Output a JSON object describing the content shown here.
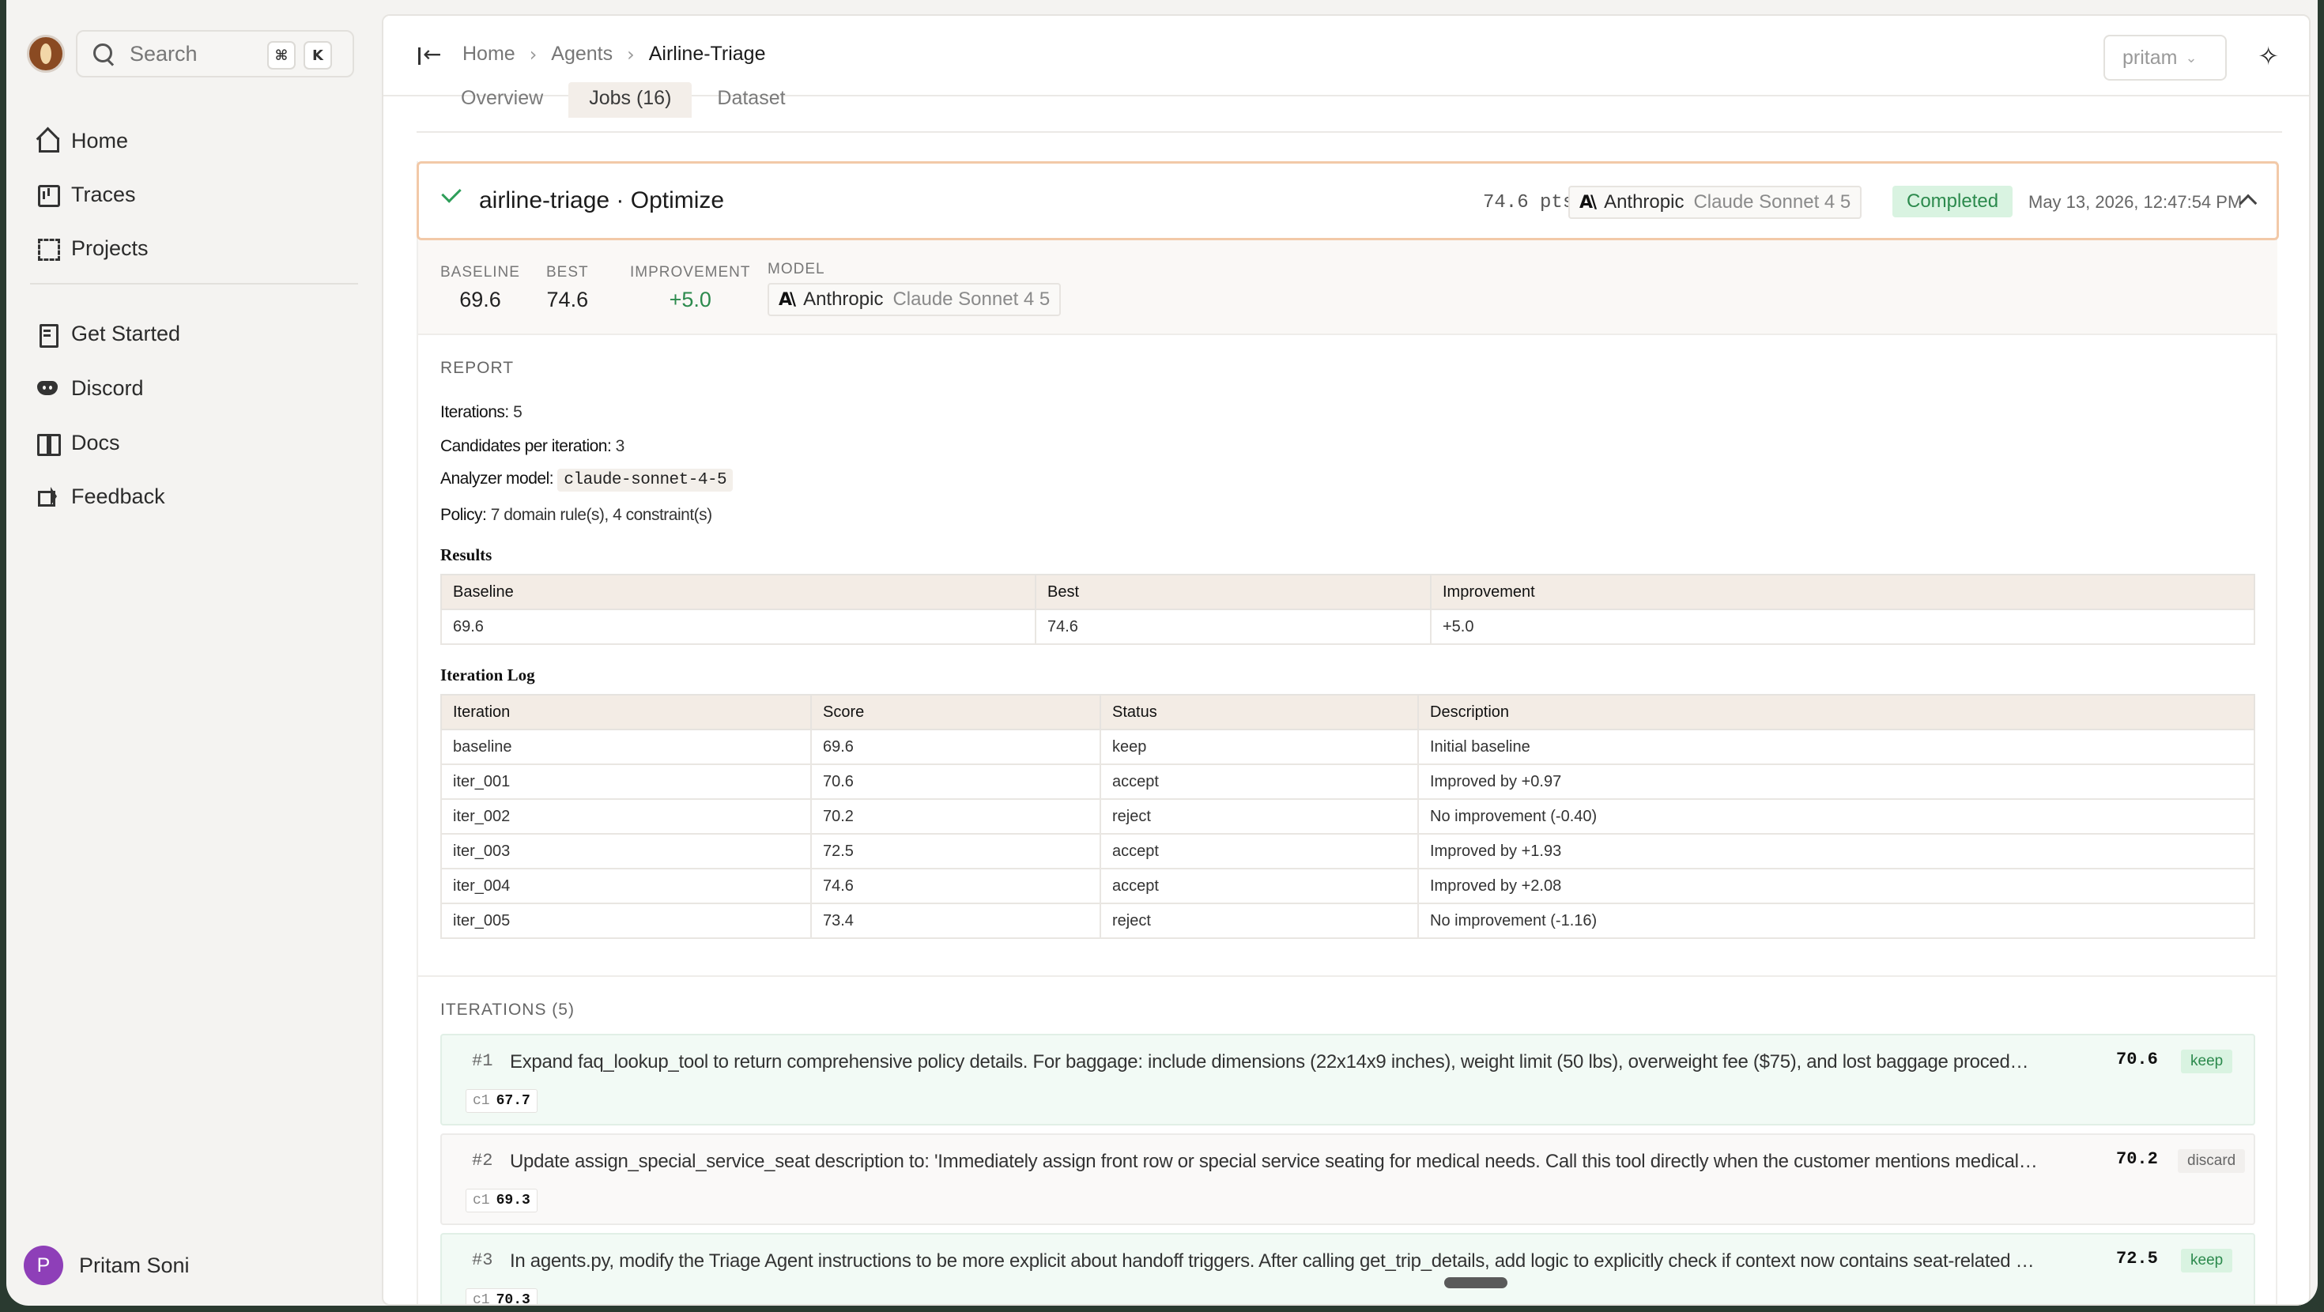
{
  "sidebar": {
    "search": {
      "placeholder": "Search",
      "shortcut_mod": "⌘",
      "shortcut_key": "K"
    },
    "nav_primary": [
      {
        "label": "Home",
        "icon": "home-icon"
      },
      {
        "label": "Traces",
        "icon": "traces-icon"
      },
      {
        "label": "Projects",
        "icon": "projects-icon"
      }
    ],
    "nav_secondary": [
      {
        "label": "Get Started",
        "icon": "get-started-icon"
      },
      {
        "label": "Discord",
        "icon": "discord-icon"
      },
      {
        "label": "Docs",
        "icon": "docs-icon"
      },
      {
        "label": "Feedback",
        "icon": "feedback-icon"
      }
    ],
    "user": {
      "initial": "P",
      "name": "Pritam Soni",
      "avatar_color": "#8e3fb8"
    }
  },
  "header": {
    "breadcrumb": [
      "Home",
      "Agents",
      "Airline-Triage"
    ],
    "user_select": "pritam"
  },
  "tabs": [
    "Overview",
    "Jobs (16)",
    "Dataset"
  ],
  "job": {
    "title": "airline-triage · Optimize",
    "points": "74.6 pts",
    "provider": "Anthropic",
    "model": "Claude Sonnet 4 5",
    "status": "Completed",
    "date": "May 13, 2026, 12:47:54 PM",
    "metrics": {
      "baseline_label": "BASELINE",
      "baseline": "69.6",
      "best_label": "BEST",
      "best": "74.6",
      "improvement_label": "IMPROVEMENT",
      "improvement": "+5.0",
      "model_label": "MODEL"
    }
  },
  "report": {
    "heading": "REPORT",
    "iterations_label": "Iterations:",
    "iterations": "5",
    "candidates_label": "Candidates per iteration:",
    "candidates": "3",
    "analyzer_label": "Analyzer model:",
    "analyzer": "claude-sonnet-4-5",
    "policy_label": "Policy:",
    "policy": "7 domain rule(s), 4 constraint(s)",
    "results_title": "Results",
    "results_headers": [
      "Baseline",
      "Best",
      "Improvement"
    ],
    "results_row": [
      "69.6",
      "74.6",
      "+5.0"
    ],
    "log_title": "Iteration Log",
    "log_headers": [
      "Iteration",
      "Score",
      "Status",
      "Description"
    ],
    "log_rows": [
      [
        "baseline",
        "69.6",
        "keep",
        "Initial baseline"
      ],
      [
        "iter_001",
        "70.6",
        "accept",
        "Improved by +0.97"
      ],
      [
        "iter_002",
        "70.2",
        "reject",
        "No improvement (-0.40)"
      ],
      [
        "iter_003",
        "72.5",
        "accept",
        "Improved by +1.93"
      ],
      [
        "iter_004",
        "74.6",
        "accept",
        "Improved by +2.08"
      ],
      [
        "iter_005",
        "73.4",
        "reject",
        "No improvement (-1.16)"
      ]
    ]
  },
  "iterations": {
    "heading": "ITERATIONS (5)",
    "items": [
      {
        "num": "#1",
        "desc": "Expand faq_lookup_tool to return comprehensive policy details. For baggage: include dimensions (22x14x9 inches), weight limit (50 lbs), overweight fee ($75), and lost baggage procedure. For ...",
        "score": "70.6",
        "tag": "keep",
        "cand_label": "c1",
        "cand_score": "67.7"
      },
      {
        "num": "#2",
        "desc": "Update assign_special_service_seat description to: 'Immediately assign front row or special service seating for medical needs. Call this tool directly when the customer mentions medical re...",
        "score": "70.2",
        "tag": "discard",
        "cand_label": "c1",
        "cand_score": "69.3"
      },
      {
        "num": "#3",
        "desc": "In agents.py, modify the Triage Agent instructions to be more explicit about handoff triggers. After calling get_trip_details, add logic to explicitly check if context now contains seat-related keyw...",
        "score": "72.5",
        "tag": "keep",
        "cand_label": "c1",
        "cand_score": "70.3"
      }
    ]
  }
}
